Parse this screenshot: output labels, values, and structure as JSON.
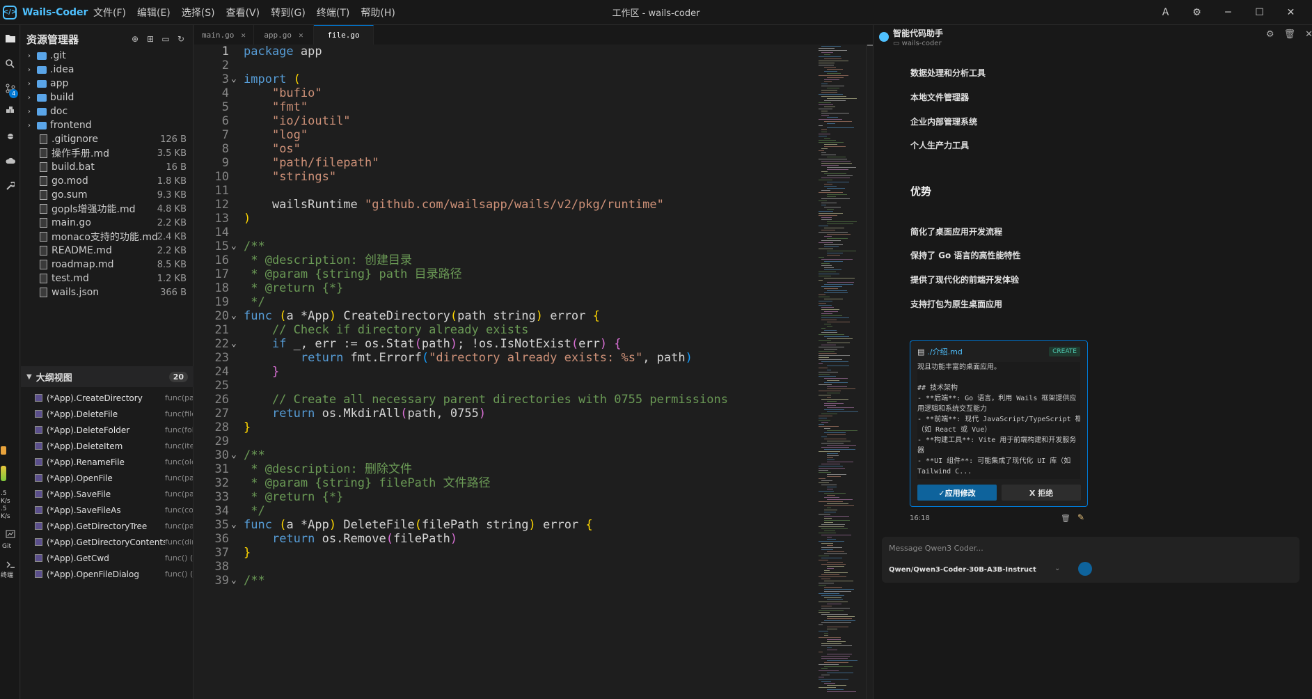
{
  "app": {
    "name": "Wails-Coder",
    "window_title": "工作区 - wails-coder"
  },
  "menu": [
    "文件(F)",
    "编辑(E)",
    "选择(S)",
    "查看(V)",
    "转到(G)",
    "终端(T)",
    "帮助(H)"
  ],
  "window_controls": {
    "account": "A",
    "settings": "⚙",
    "minimize": "─",
    "maximize": "☐",
    "close": "✕"
  },
  "activity": {
    "scm_badge": "4",
    "speed_up": ".5",
    "speed_up_unit": "K/s",
    "speed_down": ".5",
    "speed_down_unit": "K/s",
    "git_label": "Git",
    "terminal_label": "终端"
  },
  "explorer": {
    "title": "资源管理器",
    "folders": [
      ".git",
      ".idea",
      "app",
      "build",
      "doc",
      "frontend"
    ],
    "files": [
      {
        "name": ".gitignore",
        "size": "126 B"
      },
      {
        "name": "操作手册.md",
        "size": "3.5 KB"
      },
      {
        "name": "build.bat",
        "size": "16 B"
      },
      {
        "name": "go.mod",
        "size": "1.8 KB"
      },
      {
        "name": "go.sum",
        "size": "9.3 KB"
      },
      {
        "name": "gopls增强功能.md",
        "size": "4.8 KB"
      },
      {
        "name": "main.go",
        "size": "2.2 KB"
      },
      {
        "name": "monaco支持的功能.md",
        "size": "2.4 KB"
      },
      {
        "name": "README.md",
        "size": "2.2 KB"
      },
      {
        "name": "roadmap.md",
        "size": "8.5 KB"
      },
      {
        "name": "test.md",
        "size": "1.2 KB"
      },
      {
        "name": "wails.json",
        "size": "366 B"
      }
    ]
  },
  "outline": {
    "title": "大纲视图",
    "count": "20",
    "items": [
      {
        "name": "(*App).CreateDirectory",
        "sig": "func(pa"
      },
      {
        "name": "(*App).DeleteFile",
        "sig": "func(file"
      },
      {
        "name": "(*App).DeleteFolder",
        "sig": "func(fol"
      },
      {
        "name": "(*App).DeleteItem",
        "sig": "func(ite"
      },
      {
        "name": "(*App).RenameFile",
        "sig": "func(olc"
      },
      {
        "name": "(*App).OpenFile",
        "sig": "func(pa"
      },
      {
        "name": "(*App).SaveFile",
        "sig": "func(pa"
      },
      {
        "name": "(*App).SaveFileAs",
        "sig": "func(co"
      },
      {
        "name": "(*App).GetDirectoryTree",
        "sig": "func(pa"
      },
      {
        "name": "(*App).GetDirectoryContents",
        "sig": "func(dir"
      },
      {
        "name": "(*App).GetCwd",
        "sig": "func() (s"
      },
      {
        "name": "(*App).OpenFileDialog",
        "sig": "func() (s"
      }
    ]
  },
  "tabs": [
    {
      "label": "main.go",
      "active": false
    },
    {
      "label": "app.go",
      "active": false
    },
    {
      "label": "file.go",
      "active": true
    }
  ],
  "code": {
    "current_line": 1,
    "lines": [
      {
        "n": "1",
        "fold": "",
        "tokens": [
          [
            "kw",
            "package"
          ],
          [
            "",
            " app"
          ]
        ]
      },
      {
        "n": "2",
        "fold": "",
        "tokens": []
      },
      {
        "n": "3",
        "fold": "v",
        "tokens": [
          [
            "kw",
            "import"
          ],
          [
            "",
            " "
          ],
          [
            "p1",
            "("
          ]
        ]
      },
      {
        "n": "4",
        "fold": "",
        "tokens": [
          [
            "",
            "    "
          ],
          [
            "str",
            "\"bufio\""
          ]
        ]
      },
      {
        "n": "5",
        "fold": "",
        "tokens": [
          [
            "",
            "    "
          ],
          [
            "str",
            "\"fmt\""
          ]
        ]
      },
      {
        "n": "6",
        "fold": "",
        "tokens": [
          [
            "",
            "    "
          ],
          [
            "str",
            "\"io/ioutil\""
          ]
        ]
      },
      {
        "n": "7",
        "fold": "",
        "tokens": [
          [
            "",
            "    "
          ],
          [
            "str",
            "\"log\""
          ]
        ]
      },
      {
        "n": "8",
        "fold": "",
        "tokens": [
          [
            "",
            "    "
          ],
          [
            "str",
            "\"os\""
          ]
        ]
      },
      {
        "n": "9",
        "fold": "",
        "tokens": [
          [
            "",
            "    "
          ],
          [
            "str",
            "\"path/filepath\""
          ]
        ]
      },
      {
        "n": "10",
        "fold": "",
        "tokens": [
          [
            "",
            "    "
          ],
          [
            "str",
            "\"strings\""
          ]
        ]
      },
      {
        "n": "11",
        "fold": "",
        "tokens": []
      },
      {
        "n": "12",
        "fold": "",
        "tokens": [
          [
            "",
            "    wailsRuntime "
          ],
          [
            "str",
            "\"github.com/wailsapp/wails/v2/pkg/runtime\""
          ]
        ]
      },
      {
        "n": "13",
        "fold": "",
        "tokens": [
          [
            "p1",
            ")"
          ]
        ]
      },
      {
        "n": "14",
        "fold": "",
        "tokens": []
      },
      {
        "n": "15",
        "fold": "v",
        "tokens": [
          [
            "cm",
            "/**"
          ]
        ]
      },
      {
        "n": "16",
        "fold": "",
        "tokens": [
          [
            "cm",
            " * @description: 创建目录"
          ]
        ]
      },
      {
        "n": "17",
        "fold": "",
        "tokens": [
          [
            "cm",
            " * @param {string} path 目录路径"
          ]
        ]
      },
      {
        "n": "18",
        "fold": "",
        "tokens": [
          [
            "cm",
            " * @return {*}"
          ]
        ]
      },
      {
        "n": "19",
        "fold": "",
        "tokens": [
          [
            "cm",
            " */"
          ]
        ]
      },
      {
        "n": "20",
        "fold": "v",
        "tokens": [
          [
            "kw",
            "func"
          ],
          [
            "",
            " "
          ],
          [
            "p1",
            "("
          ],
          [
            "",
            "a *App"
          ],
          [
            "p1",
            ")"
          ],
          [
            "",
            " CreateDirectory"
          ],
          [
            "p1",
            "("
          ],
          [
            "",
            "path string"
          ],
          [
            "p1",
            ")"
          ],
          [
            "",
            " error "
          ],
          [
            "p1",
            "{"
          ]
        ]
      },
      {
        "n": "21",
        "fold": "",
        "tokens": [
          [
            "cm",
            "    // Check if directory already exists"
          ]
        ]
      },
      {
        "n": "22",
        "fold": "v",
        "tokens": [
          [
            "",
            "    "
          ],
          [
            "kw",
            "if"
          ],
          [
            "",
            " _, err := os.Stat"
          ],
          [
            "p2",
            "("
          ],
          [
            "",
            "path"
          ],
          [
            "p2",
            ")"
          ],
          [
            "",
            "; !os.IsNotExist"
          ],
          [
            "p2",
            "("
          ],
          [
            "",
            "err"
          ],
          [
            "p2",
            ")"
          ],
          [
            "",
            " "
          ],
          [
            "p2",
            "{"
          ]
        ]
      },
      {
        "n": "23",
        "fold": "",
        "tokens": [
          [
            "",
            "        "
          ],
          [
            "kw",
            "return"
          ],
          [
            "",
            " fmt.Errorf"
          ],
          [
            "p3",
            "("
          ],
          [
            "str",
            "\"directory already exists: %s\""
          ],
          [
            "",
            ", path"
          ],
          [
            "p3",
            ")"
          ]
        ]
      },
      {
        "n": "24",
        "fold": "",
        "tokens": [
          [
            "",
            "    "
          ],
          [
            "p2",
            "}"
          ]
        ]
      },
      {
        "n": "25",
        "fold": "",
        "tokens": []
      },
      {
        "n": "26",
        "fold": "",
        "tokens": [
          [
            "cm",
            "    // Create all necessary parent directories with 0755 permissions"
          ]
        ]
      },
      {
        "n": "27",
        "fold": "",
        "tokens": [
          [
            "",
            "    "
          ],
          [
            "kw",
            "return"
          ],
          [
            "",
            " os.MkdirAll"
          ],
          [
            "p2",
            "("
          ],
          [
            "",
            "path, 0755"
          ],
          [
            "p2",
            ")"
          ]
        ]
      },
      {
        "n": "28",
        "fold": "",
        "tokens": [
          [
            "p1",
            "}"
          ]
        ]
      },
      {
        "n": "29",
        "fold": "",
        "tokens": []
      },
      {
        "n": "30",
        "fold": "v",
        "tokens": [
          [
            "cm",
            "/**"
          ]
        ]
      },
      {
        "n": "31",
        "fold": "",
        "tokens": [
          [
            "cm",
            " * @description: 删除文件"
          ]
        ]
      },
      {
        "n": "32",
        "fold": "",
        "tokens": [
          [
            "cm",
            " * @param {string} filePath 文件路径"
          ]
        ]
      },
      {
        "n": "33",
        "fold": "",
        "tokens": [
          [
            "cm",
            " * @return {*}"
          ]
        ]
      },
      {
        "n": "34",
        "fold": "",
        "tokens": [
          [
            "cm",
            " */"
          ]
        ]
      },
      {
        "n": "35",
        "fold": "v",
        "tokens": [
          [
            "kw",
            "func"
          ],
          [
            "",
            " "
          ],
          [
            "p1",
            "("
          ],
          [
            "",
            "a *App"
          ],
          [
            "p1",
            ")"
          ],
          [
            "",
            " DeleteFile"
          ],
          [
            "p1",
            "("
          ],
          [
            "",
            "filePath string"
          ],
          [
            "p1",
            ")"
          ],
          [
            "",
            " error "
          ],
          [
            "p1",
            "{"
          ]
        ]
      },
      {
        "n": "36",
        "fold": "",
        "tokens": [
          [
            "",
            "    "
          ],
          [
            "kw",
            "return"
          ],
          [
            "",
            " os.Remove"
          ],
          [
            "p2",
            "("
          ],
          [
            "",
            "filePath"
          ],
          [
            "p2",
            ")"
          ]
        ]
      },
      {
        "n": "37",
        "fold": "",
        "tokens": [
          [
            "p1",
            "}"
          ]
        ]
      },
      {
        "n": "38",
        "fold": "",
        "tokens": []
      },
      {
        "n": "39",
        "fold": "v",
        "tokens": [
          [
            "cm",
            "/**"
          ]
        ]
      }
    ]
  },
  "syntax_colors": {
    "kw": "#569cd6",
    "str": "#ce9178",
    "cm": "#6a9955",
    "p1": "#ffd700",
    "p2": "#da70d6",
    "p3": "#179fff"
  },
  "assistant": {
    "title": "智能代码助手",
    "workspace": "wails-coder",
    "list_items": [
      "数据处理和分析工具",
      "本地文件管理器",
      "企业内部管理系统",
      "个人生产力工具"
    ],
    "section_heading": "优势",
    "advantages": [
      "简化了桌面应用开发流程",
      "保持了 Go 语言的高性能特性",
      "提供了现代化的前端开发体验",
      "支持打包为原生桌面应用"
    ],
    "change_card": {
      "file": "./介绍.md",
      "badge": "CREATE",
      "lines": [
        "观且功能丰富的桌面应用。",
        "",
        "## 技术架构",
        "- **后端**: Go 语言，利用 Wails 框架提供应",
        "用逻辑和系统交互能力",
        "- **前端**: 现代 JavaScript/TypeScript 框架",
        "（如 React 或 Vue）",
        "- **构建工具**: Vite 用于前端构建和开发服务",
        "器",
        "- **UI 组件**: 可能集成了现代化 UI 库（如",
        "Tailwind C..."
      ],
      "apply_label": "✓应用修改",
      "reject_label": "X 拒绝"
    },
    "time": "16:18",
    "input_placeholder": "Message Qwen3 Coder...",
    "model": "Qwen/Qwen3-Coder-30B-A3B-Instruct"
  },
  "accent": "#0078d4"
}
